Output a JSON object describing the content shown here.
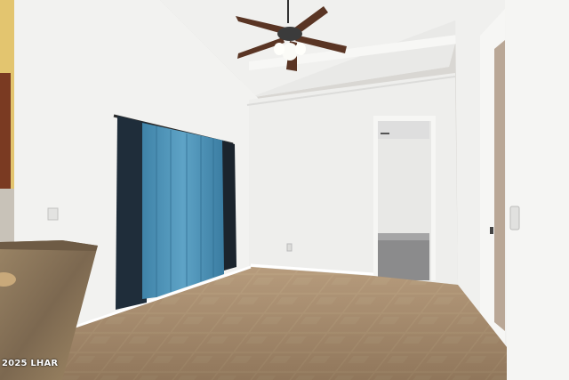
{
  "image": {
    "kind": "real-estate interior photograph",
    "watermark": "2025 LHAR"
  },
  "colors": {
    "wall": "#f1f1ef",
    "ceiling": "#f4f4f2",
    "floor_tile": "#a88c6d",
    "curtain": "#4a8fb3",
    "curtain_dark": "#1d2a36",
    "countertop": "#8a7458",
    "cabinet": "#7a3a22",
    "fan_blade": "#5a3524"
  },
  "icons": [
    "ceiling-fan-icon",
    "light-switch-icon",
    "outlet-icon",
    "door-handle-icon"
  ]
}
